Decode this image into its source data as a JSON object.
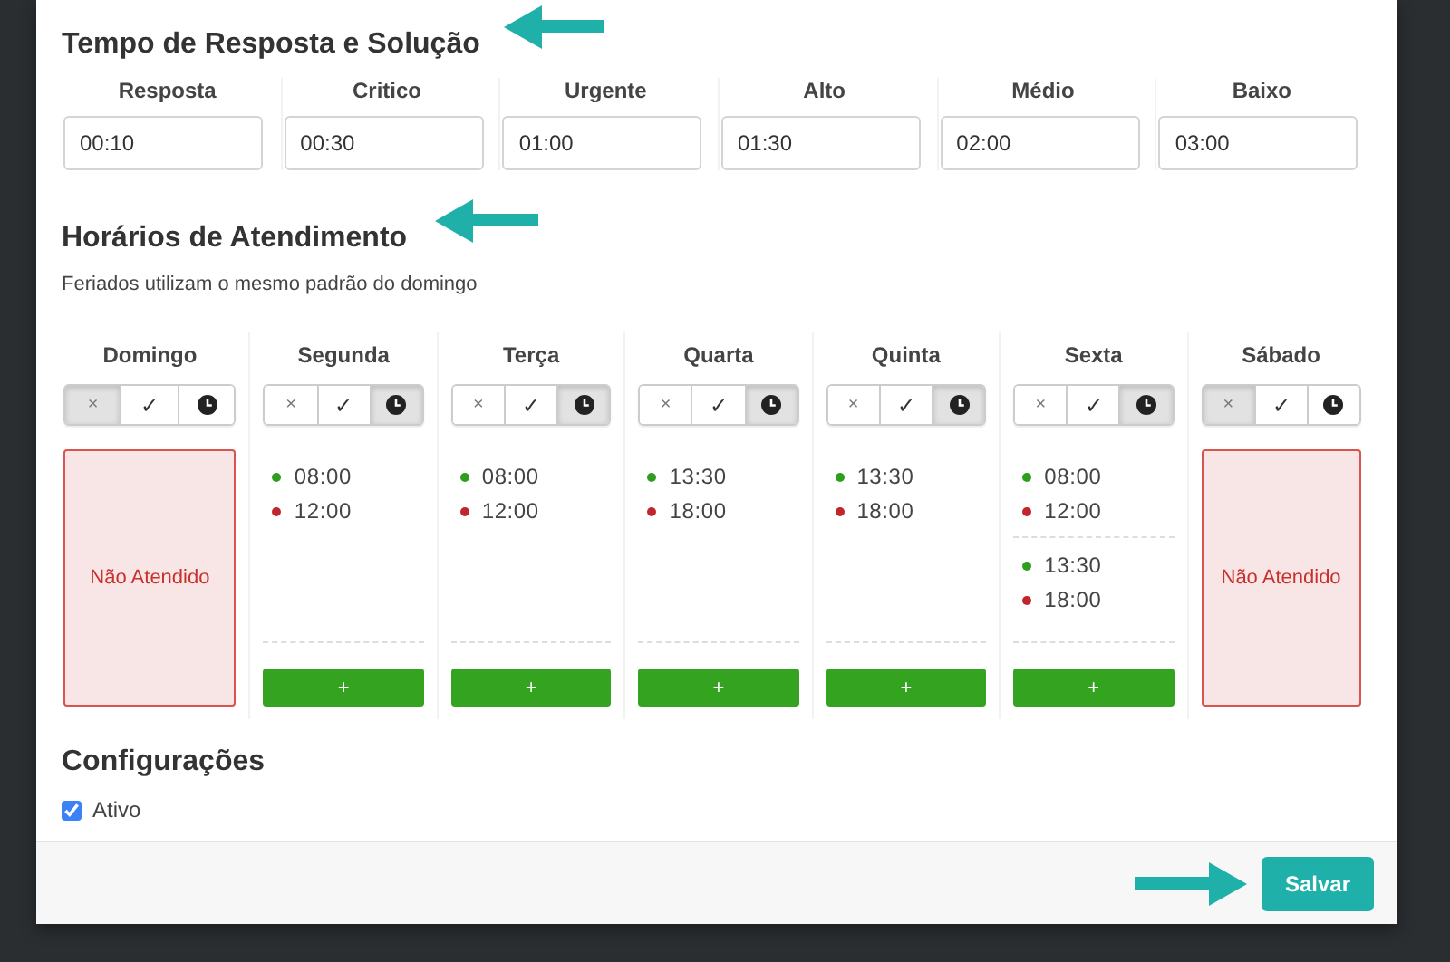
{
  "sla": {
    "title": "Tempo de Resposta e Solução",
    "fields": [
      {
        "label": "Resposta",
        "value": "00:10"
      },
      {
        "label": "Critico",
        "value": "00:30"
      },
      {
        "label": "Urgente",
        "value": "01:00"
      },
      {
        "label": "Alto",
        "value": "01:30"
      },
      {
        "label": "Médio",
        "value": "02:00"
      },
      {
        "label": "Baixo",
        "value": "03:00"
      }
    ]
  },
  "schedule": {
    "title": "Horários de Atendimento",
    "note": "Feriados utilizam o mesmo padrão do domingo",
    "days": [
      {
        "name": "Domingo",
        "modes": [
          {
            "kind": "closed",
            "glyph": "×",
            "selected": true
          },
          {
            "kind": "open",
            "glyph": "✓",
            "selected": false
          },
          {
            "kind": "hours",
            "selected": false
          }
        ],
        "closed_label": "Não Atendido"
      },
      {
        "name": "Segunda",
        "modes": [
          {
            "kind": "closed",
            "glyph": "×",
            "selected": false
          },
          {
            "kind": "open",
            "glyph": "✓",
            "selected": false
          },
          {
            "kind": "hours",
            "selected": true
          }
        ],
        "periods": [
          {
            "start": "08:00",
            "end": "12:00"
          }
        ],
        "add_label": "+"
      },
      {
        "name": "Terça",
        "modes": [
          {
            "kind": "closed",
            "glyph": "×",
            "selected": false
          },
          {
            "kind": "open",
            "glyph": "✓",
            "selected": false
          },
          {
            "kind": "hours",
            "selected": true
          }
        ],
        "periods": [
          {
            "start": "08:00",
            "end": "12:00"
          }
        ],
        "add_label": "+"
      },
      {
        "name": "Quarta",
        "modes": [
          {
            "kind": "closed",
            "glyph": "×",
            "selected": false
          },
          {
            "kind": "open",
            "glyph": "✓",
            "selected": false
          },
          {
            "kind": "hours",
            "selected": true
          }
        ],
        "periods": [
          {
            "start": "13:30",
            "end": "18:00"
          }
        ],
        "add_label": "+"
      },
      {
        "name": "Quinta",
        "modes": [
          {
            "kind": "closed",
            "glyph": "×",
            "selected": false
          },
          {
            "kind": "open",
            "glyph": "✓",
            "selected": false
          },
          {
            "kind": "hours",
            "selected": true
          }
        ],
        "periods": [
          {
            "start": "13:30",
            "end": "18:00"
          }
        ],
        "add_label": "+"
      },
      {
        "name": "Sexta",
        "modes": [
          {
            "kind": "closed",
            "glyph": "×",
            "selected": false
          },
          {
            "kind": "open",
            "glyph": "✓",
            "selected": false
          },
          {
            "kind": "hours",
            "selected": true
          }
        ],
        "periods": [
          {
            "start": "08:00",
            "end": "12:00"
          },
          {
            "start": "13:30",
            "end": "18:00"
          }
        ],
        "add_label": "+"
      },
      {
        "name": "Sábado",
        "modes": [
          {
            "kind": "closed",
            "glyph": "×",
            "selected": true
          },
          {
            "kind": "open",
            "glyph": "✓",
            "selected": false
          },
          {
            "kind": "hours",
            "selected": false
          }
        ],
        "closed_label": "Não Atendido"
      }
    ]
  },
  "settings": {
    "title": "Configurações",
    "options": [
      {
        "label": "Ativo",
        "checked": true
      }
    ]
  },
  "footer": {
    "save_label": "Salvar"
  }
}
